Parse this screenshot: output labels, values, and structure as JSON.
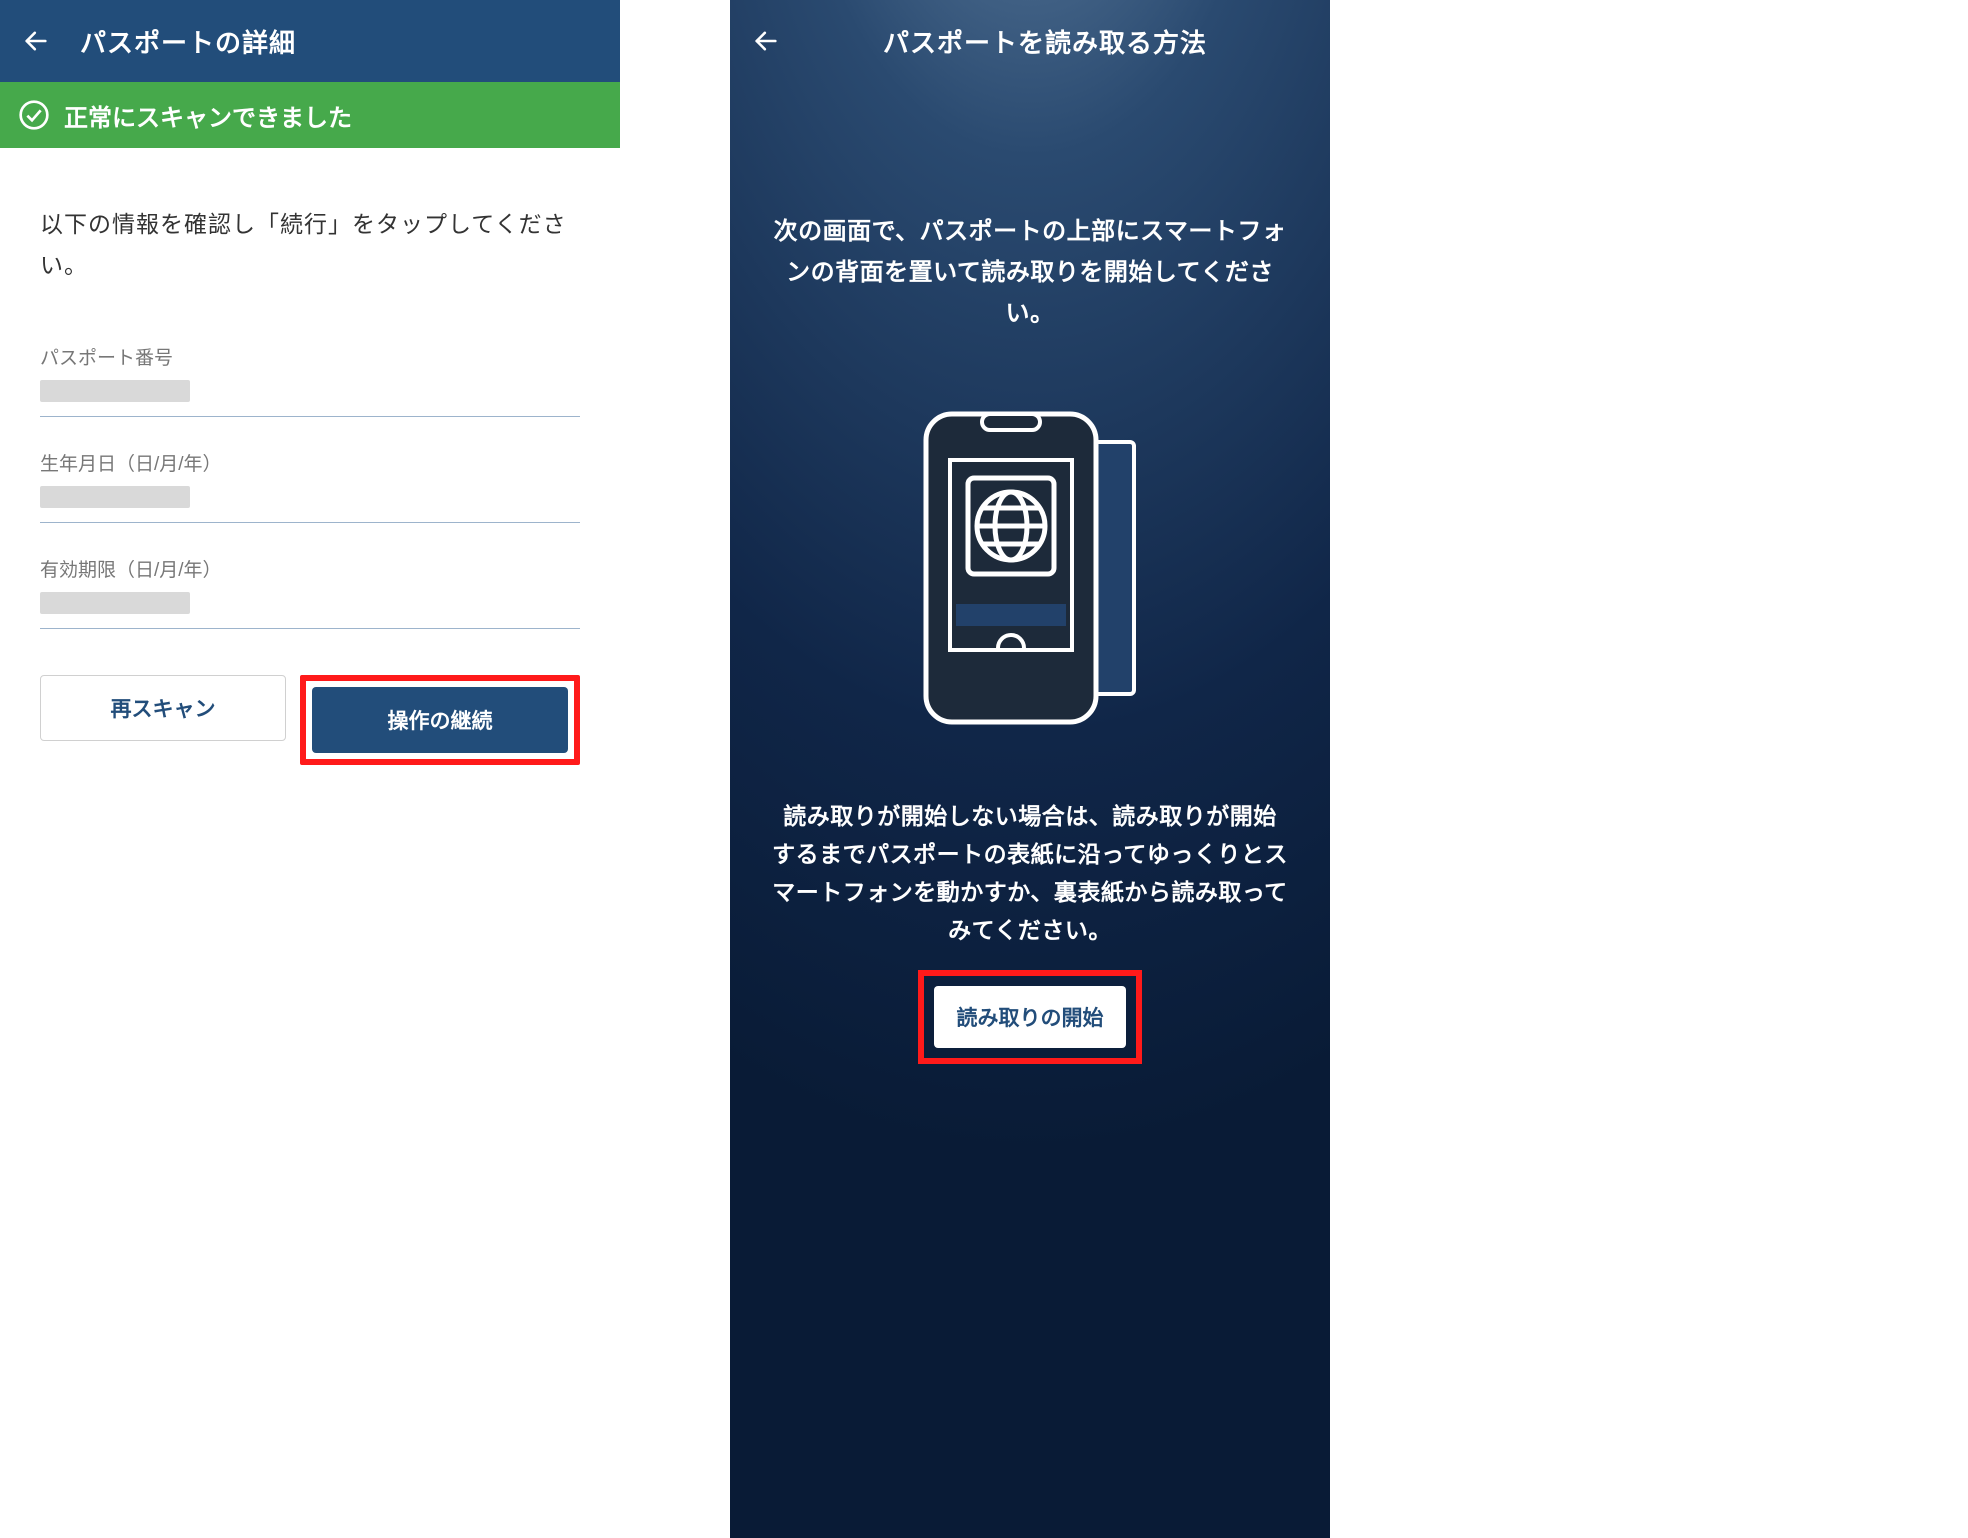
{
  "left": {
    "header": {
      "title": "パスポートの詳細"
    },
    "banner": {
      "text": "正常にスキャンできました"
    },
    "prompt": "以下の情報を確認し「続行」をタップしてください。",
    "fields": {
      "passport_label": "パスポート番号",
      "dob_label": "生年月日（日/月/年）",
      "exp_label": "有効期限（日/月/年）"
    },
    "buttons": {
      "rescan": "再スキャン",
      "continue": "操作の継続"
    }
  },
  "right": {
    "header": {
      "title": "パスポートを読み取る方法"
    },
    "instruction": "次の画面で、パスポートの上部にスマートフォンの背面を置いて読み取りを開始してください。",
    "hint": "読み取りが開始しない場合は、読み取りが開始するまでパスポートの表紙に沿ってゆっくりとスマートフォンを動かすか、裏表紙から読み取ってみてください。",
    "buttons": {
      "start": "読み取りの開始"
    }
  }
}
